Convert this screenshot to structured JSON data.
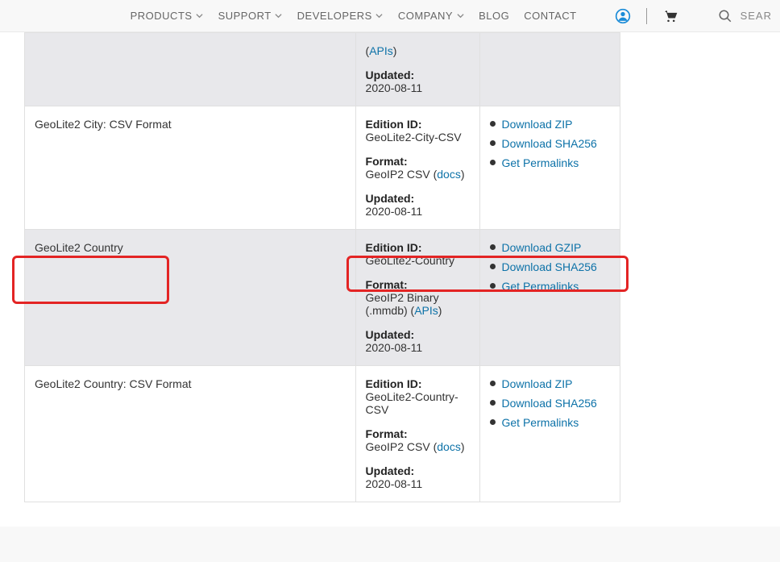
{
  "nav": {
    "products": "PRODUCTS",
    "support": "SUPPORT",
    "developers": "DEVELOPERS",
    "company": "COMPANY",
    "blog": "BLOG",
    "contact": "CONTACT",
    "search": "SEAR"
  },
  "labels": {
    "edition_id": "Edition ID:",
    "format": "Format:",
    "updated": "Updated:",
    "docs": "docs",
    "apis": "APIs"
  },
  "rows": [
    {
      "name": "",
      "alt": true,
      "partial": true,
      "edition": "",
      "format_prefix": "",
      "format_link": "APIs",
      "format_link_key": "apis",
      "updated": "2020-08-11",
      "downloads": []
    },
    {
      "name": "GeoLite2 City: CSV Format",
      "alt": false,
      "edition": "GeoLite2-City-CSV",
      "format_prefix": "GeoIP2 CSV (",
      "format_link": "docs",
      "format_link_key": "docs",
      "format_suffix": ")",
      "updated": "2020-08-11",
      "downloads": [
        "Download ZIP",
        "Download SHA256",
        "Get Permalinks"
      ]
    },
    {
      "name": "GeoLite2 Country",
      "alt": true,
      "edition": "GeoLite2-Country",
      "format_prefix": "GeoIP2 Binary (.mmdb) (",
      "format_link": "APIs",
      "format_link_key": "apis",
      "format_suffix": ")",
      "updated": "2020-08-11",
      "downloads": [
        "Download GZIP",
        "Download SHA256",
        "Get Permalinks"
      ]
    },
    {
      "name": "GeoLite2 Country: CSV Format",
      "alt": false,
      "edition": "GeoLite2-Country-CSV",
      "format_prefix": "GeoIP2 CSV (",
      "format_link": "docs",
      "format_link_key": "docs",
      "format_suffix": ")",
      "updated": "2020-08-11",
      "downloads": [
        "Download ZIP",
        "Download SHA256",
        "Get Permalinks"
      ]
    }
  ]
}
